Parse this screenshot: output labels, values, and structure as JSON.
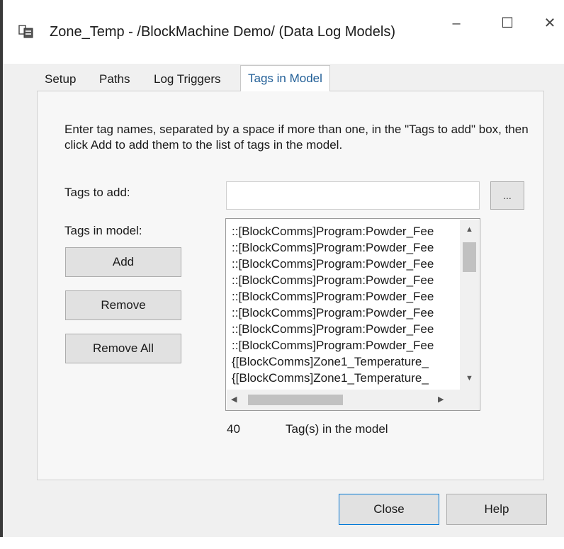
{
  "window": {
    "title": "Zone_Temp - /BlockMachine Demo/ (Data Log Models)",
    "minimize_label": "–",
    "maximize_label": "☐",
    "close_label": "✕",
    "icon": "data-log-model-icon"
  },
  "tabs": [
    {
      "label": "Setup"
    },
    {
      "label": "Paths"
    },
    {
      "label": "Log Triggers"
    },
    {
      "label": "Tags in Model",
      "active": true
    }
  ],
  "instructions": "Enter tag names, separated by a space if more than one, in the \"Tags to add\" box, then click Add to add them to the list of tags in the model.",
  "tags_to_add": {
    "label": "Tags to add:",
    "value": "",
    "browse_label": "..."
  },
  "tags_in_model": {
    "label": "Tags in model:",
    "items": [
      "::[BlockComms]Program:Powder_Fee",
      "::[BlockComms]Program:Powder_Fee",
      "::[BlockComms]Program:Powder_Fee",
      "::[BlockComms]Program:Powder_Fee",
      "::[BlockComms]Program:Powder_Fee",
      "::[BlockComms]Program:Powder_Fee",
      "::[BlockComms]Program:Powder_Fee",
      "::[BlockComms]Program:Powder_Fee",
      "{[BlockComms]Zone1_Temperature_",
      "{[BlockComms]Zone1_Temperature_"
    ]
  },
  "buttons": {
    "add": "Add",
    "remove": "Remove",
    "remove_all": "Remove All",
    "close": "Close",
    "help": "Help"
  },
  "count": {
    "value": "40",
    "label": "Tag(s) in the model"
  },
  "colors": {
    "active_tab_text": "#1f5d96",
    "default_button_border": "#0078d7"
  }
}
